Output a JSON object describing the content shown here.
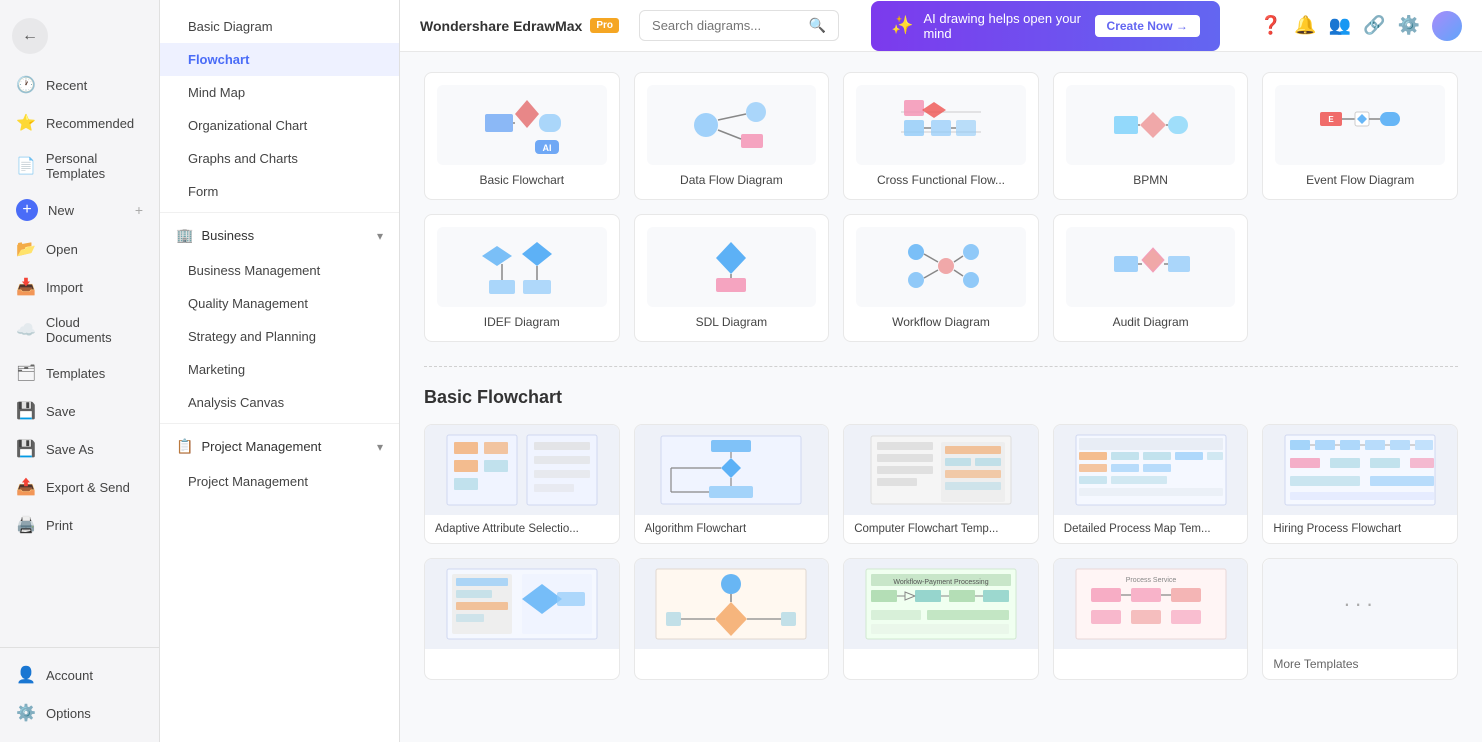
{
  "app": {
    "title": "Wondershare EdrawMax",
    "pro_badge": "Pro"
  },
  "topbar": {
    "search_placeholder": "Search diagrams...",
    "ai_banner_text": "AI drawing helps open your mind",
    "create_now": "Create Now →"
  },
  "sidebar": {
    "back_label": "←",
    "items": [
      {
        "id": "recent",
        "label": "Recent",
        "icon": "🕐"
      },
      {
        "id": "recommended",
        "label": "Recommended",
        "icon": "⭐"
      },
      {
        "id": "personal-templates",
        "label": "Personal Templates",
        "icon": "📄"
      },
      {
        "id": "new",
        "label": "New",
        "icon": "+"
      },
      {
        "id": "open",
        "label": "Open",
        "icon": "📂"
      },
      {
        "id": "import",
        "label": "Import",
        "icon": "📥"
      },
      {
        "id": "cloud-documents",
        "label": "Cloud Documents",
        "icon": "☁️"
      },
      {
        "id": "templates",
        "label": "Templates",
        "icon": "🗂"
      },
      {
        "id": "save",
        "label": "Save",
        "icon": "💾"
      },
      {
        "id": "save-as",
        "label": "Save As",
        "icon": "💾"
      },
      {
        "id": "export-send",
        "label": "Export & Send",
        "icon": "📤"
      },
      {
        "id": "print",
        "label": "Print",
        "icon": "🖨️"
      },
      {
        "id": "account",
        "label": "Account",
        "icon": "👤"
      },
      {
        "id": "options",
        "label": "Options",
        "icon": "⚙️"
      }
    ]
  },
  "nav_panel": {
    "categories": [
      {
        "id": "basic-diagram",
        "label": "Basic Diagram",
        "type": "item"
      },
      {
        "id": "flowchart",
        "label": "Flowchart",
        "type": "item",
        "active": true
      },
      {
        "id": "mind-map",
        "label": "Mind Map",
        "type": "item"
      },
      {
        "id": "organizational-chart",
        "label": "Organizational Chart",
        "type": "item"
      },
      {
        "id": "graphs-and-charts",
        "label": "Graphs and Charts",
        "type": "item"
      },
      {
        "id": "form",
        "label": "Form",
        "type": "item"
      }
    ],
    "groups": [
      {
        "id": "business",
        "label": "Business",
        "items": [
          {
            "id": "business-management",
            "label": "Business Management"
          },
          {
            "id": "quality-management",
            "label": "Quality Management"
          },
          {
            "id": "strategy-and-planning",
            "label": "Strategy and Planning"
          },
          {
            "id": "marketing",
            "label": "Marketing"
          },
          {
            "id": "analysis-canvas",
            "label": "Analysis Canvas"
          }
        ]
      },
      {
        "id": "project-management",
        "label": "Project Management",
        "items": [
          {
            "id": "project-management-item",
            "label": "Project Management"
          }
        ]
      }
    ]
  },
  "diagram_section": {
    "items": [
      {
        "id": "basic-flowchart",
        "label": "Basic Flowchart",
        "has_ai": true
      },
      {
        "id": "data-flow-diagram",
        "label": "Data Flow Diagram"
      },
      {
        "id": "cross-functional-flow",
        "label": "Cross Functional Flow..."
      },
      {
        "id": "bpmn",
        "label": "BPMN"
      },
      {
        "id": "event-flow-diagram",
        "label": "Event Flow Diagram"
      },
      {
        "id": "idef-diagram",
        "label": "IDEF Diagram"
      },
      {
        "id": "sdl-diagram",
        "label": "SDL Diagram"
      },
      {
        "id": "workflow-diagram",
        "label": "Workflow Diagram"
      },
      {
        "id": "audit-diagram",
        "label": "Audit Diagram"
      }
    ]
  },
  "template_section": {
    "title": "Basic Flowchart",
    "items": [
      {
        "id": "adaptive-attr",
        "label": "Adaptive Attribute Selectio..."
      },
      {
        "id": "algorithm-flowchart",
        "label": "Algorithm Flowchart"
      },
      {
        "id": "computer-flowchart",
        "label": "Computer Flowchart Temp..."
      },
      {
        "id": "detailed-process-map",
        "label": "Detailed Process Map Tem..."
      },
      {
        "id": "hiring-process",
        "label": "Hiring Process Flowchart"
      }
    ],
    "row2": [
      {
        "id": "tmpl-1",
        "label": ""
      },
      {
        "id": "tmpl-2",
        "label": ""
      },
      {
        "id": "tmpl-3",
        "label": ""
      },
      {
        "id": "tmpl-4",
        "label": ""
      },
      {
        "id": "more-templates",
        "label": "More Templates",
        "is_more": true
      }
    ]
  }
}
